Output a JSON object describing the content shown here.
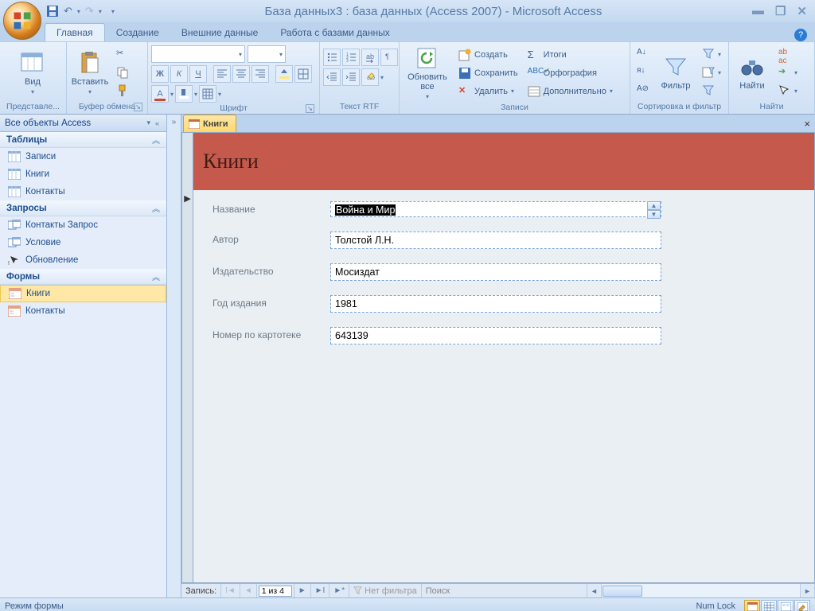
{
  "title": "База данных3 : база данных (Access 2007) - Microsoft Access",
  "ribbon": {
    "tabs": [
      "Главная",
      "Создание",
      "Внешние данные",
      "Работа с базами данных"
    ],
    "active_tab": "Главная",
    "groups": {
      "views": {
        "label": "Представле...",
        "view_btn": "Вид"
      },
      "clipboard": {
        "label": "Буфер обмена",
        "paste_btn": "Вставить"
      },
      "font": {
        "label": "Шрифт"
      },
      "richtext": {
        "label": "Текст RTF"
      },
      "records": {
        "label": "Записи",
        "refresh": "Обновить все",
        "new": "Создать",
        "save": "Сохранить",
        "delete": "Удалить",
        "totals": "Итоги",
        "spelling": "Орфография",
        "more": "Дополнительно"
      },
      "sortfilter": {
        "label": "Сортировка и фильтр",
        "filter_btn": "Фильтр"
      },
      "find": {
        "label": "Найти",
        "find_btn": "Найти"
      }
    }
  },
  "nav": {
    "header": "Все объекты Access",
    "groups": [
      {
        "title": "Таблицы",
        "items": [
          "Записи",
          "Книги",
          "Контакты"
        ],
        "type": "table"
      },
      {
        "title": "Запросы",
        "items": [
          "Контакты Запрос",
          "Условие",
          "Обновление"
        ],
        "type": "query"
      },
      {
        "title": "Формы",
        "items": [
          "Книги",
          "Контакты"
        ],
        "type": "form",
        "selected": 0
      }
    ]
  },
  "doc": {
    "tab_label": "Книги",
    "form_title": "Книги",
    "fields": [
      {
        "label": "Название",
        "value": "Война и Мир",
        "multiline": true,
        "selected": true
      },
      {
        "label": "Автор",
        "value": "Толстой Л.Н."
      },
      {
        "label": "Издательство",
        "value": "Мосиздат"
      },
      {
        "label": "Год издания",
        "value": "1981"
      },
      {
        "label": "Номер по картотеке",
        "value": "643139"
      }
    ]
  },
  "recnav": {
    "label": "Запись:",
    "pos": "1 из 4",
    "filter": "Нет фильтра",
    "search": "Поиск"
  },
  "status": {
    "mode": "Режим формы",
    "numlock": "Num Lock"
  }
}
